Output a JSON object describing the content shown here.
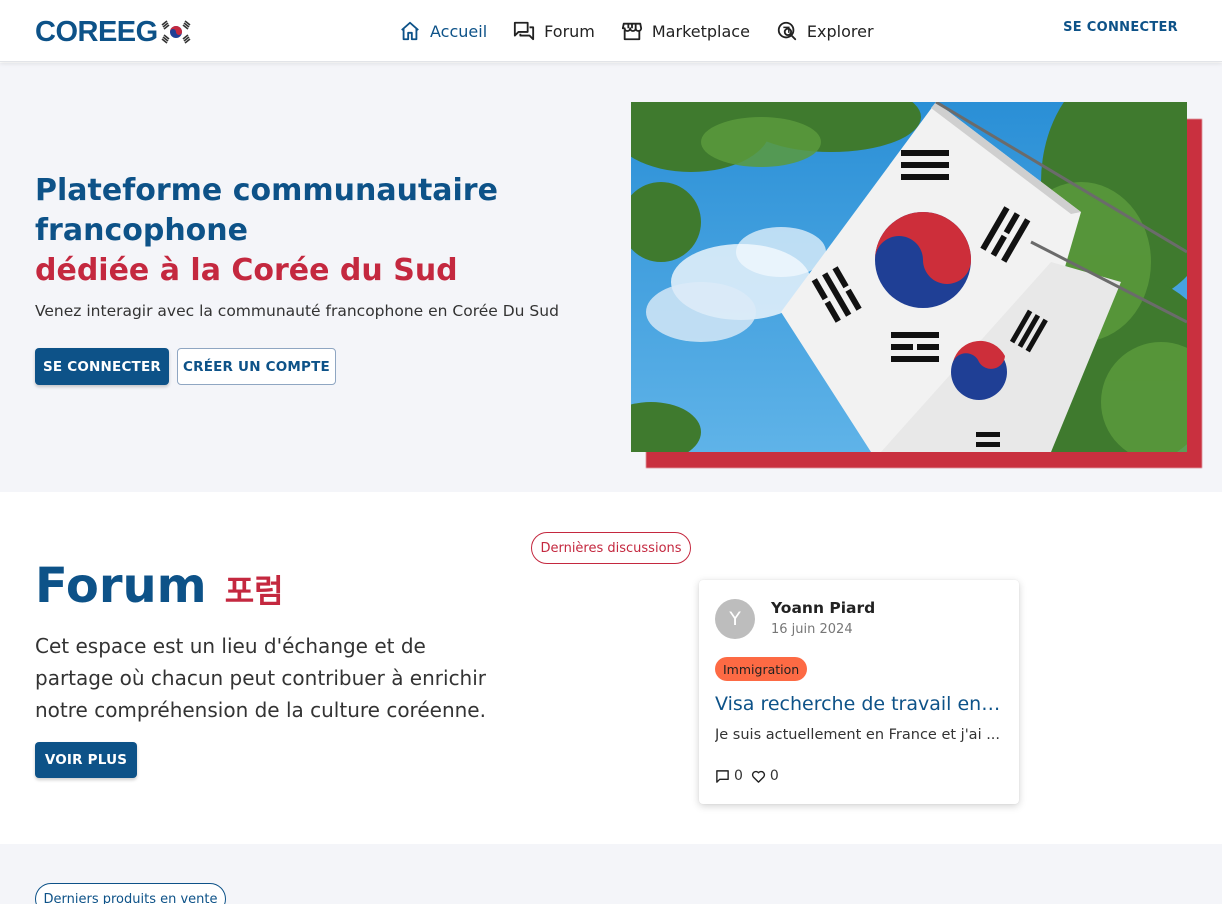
{
  "header": {
    "logo_text": "COREEG",
    "nav": [
      {
        "label": "Accueil",
        "icon": "home-icon",
        "active": true
      },
      {
        "label": "Forum",
        "icon": "forum-icon"
      },
      {
        "label": "Marketplace",
        "icon": "store-icon"
      },
      {
        "label": "Explorer",
        "icon": "explore-icon"
      }
    ],
    "login_label": "SE CONNECTER"
  },
  "hero": {
    "title_line1": "Plateforme communautaire",
    "title_line2": "francophone",
    "title_accent": "dédiée à la Corée du Sud",
    "subtitle": "Venez interagir avec la communauté francophone en Corée Du Sud",
    "login_button": "SE CONNECTER",
    "register_button": "CRÉER UN COMPTE"
  },
  "forum": {
    "badge": "Dernières discussions",
    "title": "Forum",
    "title_korean": "포럼",
    "description": "Cet espace est un lieu d'échange et de partage où chacun peut contribuer à enrichir notre compréhension de la culture coréenne.",
    "more_button": "VOIR PLUS",
    "post": {
      "avatar_initial": "Y",
      "author": "Yoann Piard",
      "date": "16 juin 2024",
      "tag": "Immigration",
      "title": "Visa recherche de travail en ...",
      "excerpt": "Je suis actuellement en France et j'ai ...",
      "comments": "0",
      "likes": "0"
    }
  },
  "marketplace": {
    "badge": "Derniers produits en vente"
  },
  "colors": {
    "primary": "#0d5288",
    "accent": "#c4283f",
    "tag": "#fd6a44",
    "hero_bg": "#f4f5f9"
  }
}
